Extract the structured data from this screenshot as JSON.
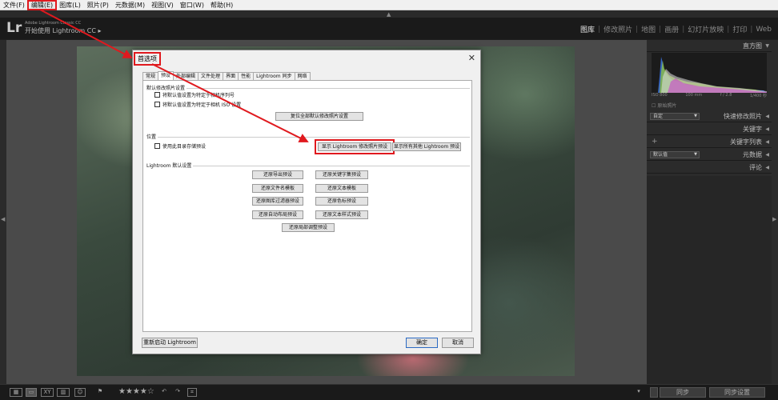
{
  "menu": [
    "文件(F)",
    "编辑(E)",
    "图库(L)",
    "照片(P)",
    "元数据(M)",
    "视图(V)",
    "窗口(W)",
    "帮助(H)"
  ],
  "identity": {
    "logo": "Lr",
    "subtitle": "Adobe Lightroom Classic CC",
    "title": "开始使用 Lightroom CC",
    "title_arrow": "▸"
  },
  "modules": [
    "图库",
    "修改照片",
    "地图",
    "画册",
    "幻灯片放映",
    "打印",
    "Web"
  ],
  "active_module": "图库",
  "right_panel": {
    "histogram": "直方图",
    "iso": "ISO 800",
    "focal": "100 mm",
    "aperture": "f / 2.8",
    "shutter": "1/400 秒",
    "original_photo": "原始照片",
    "saved_preset_value": "自定",
    "quick_develop": "快速修改照片",
    "keywording": "关键字",
    "keyword_list_plus": "+",
    "keyword_list": "关键字列表",
    "metadata_preset_value": "默认值",
    "metadata": "元数据",
    "comments": "评论"
  },
  "bottom_bar": {
    "stars": "★★★★☆",
    "sync": "同步",
    "sync_settings": "同步设置"
  },
  "dialog": {
    "title": "首选项",
    "close": "✕",
    "tabs": [
      "常规",
      "预设",
      "外部编辑",
      "文件处理",
      "界面",
      "性能",
      "Lightroom 同步",
      "网络"
    ],
    "active_tab": "预设",
    "group1_label": "默认修改照片设置",
    "chk1": "将默认值设置为特定于相机序列号",
    "chk2": "将默认值设置为特定于相机 ISO 设置",
    "reset_all_btn": "复位全部默认修改照片设置",
    "group2_label": "位置",
    "store_with_catalog": "使用此目录存储预设",
    "show_lr_presets_btn": "显示 Lightroom 修改照片预设",
    "show_all_presets_btn": "显示所有其他 Lightroom 预设",
    "group3_label": "Lightroom 默认设置",
    "restore_buttons": [
      "还原导出预设",
      "还原关键字集预设",
      "还原文件名模板",
      "还原文本模板",
      "还原图库过滤器预设",
      "还原色标预设",
      "还原自动布局预设",
      "还原文本样式预设",
      "还原局部调整预设"
    ],
    "restart_btn": "重新启动 Lightroom",
    "ok_btn": "确定",
    "cancel_btn": "取消"
  },
  "colors": {
    "annotation": "#e0191e",
    "dark_bg": "#1f1f1f",
    "dialog_bg": "#f0f0f0"
  }
}
